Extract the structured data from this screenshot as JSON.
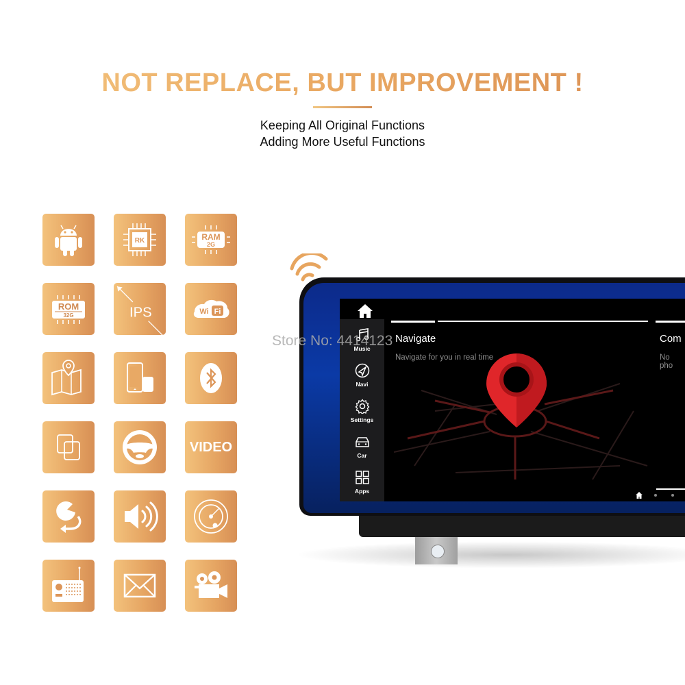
{
  "header": {
    "title": "NOT REPLACE, BUT IMPROVEMENT !",
    "subtitle_line1": "Keeping All Original Functions",
    "subtitle_line2": "Adding More Useful Functions",
    "accent_gradient": [
      "#f4c47e",
      "#d98e53"
    ]
  },
  "features": [
    {
      "icon": "android-icon",
      "label": ""
    },
    {
      "icon": "cpu-chip-icon",
      "label": "RK"
    },
    {
      "icon": "ram-chip-icon",
      "label": "RAM",
      "sublabel": "2G"
    },
    {
      "icon": "rom-chip-icon",
      "label": "ROM",
      "sublabel": "32G"
    },
    {
      "icon": "ips-screen-icon",
      "label": "IPS"
    },
    {
      "icon": "wifi-icon",
      "label": "Wi",
      "sublabel": "Fi"
    },
    {
      "icon": "map-pin-icon",
      "label": ""
    },
    {
      "icon": "phone-mirror-icon",
      "label": ""
    },
    {
      "icon": "bluetooth-icon",
      "label": ""
    },
    {
      "icon": "multi-window-icon",
      "label": ""
    },
    {
      "icon": "steering-wheel-icon",
      "label": ""
    },
    {
      "icon": "video-icon",
      "label": "VIDEO"
    },
    {
      "icon": "rotate-icon",
      "label": ""
    },
    {
      "icon": "speaker-icon",
      "label": ""
    },
    {
      "icon": "radar-icon",
      "label": ""
    },
    {
      "icon": "radio-icon",
      "label": ""
    },
    {
      "icon": "mail-icon",
      "label": ""
    },
    {
      "icon": "camera-icon",
      "label": ""
    }
  ],
  "device": {
    "watermark": "Store No: 4414123",
    "sidebar": [
      {
        "icon": "music-icon",
        "label": "Music"
      },
      {
        "icon": "navi-icon",
        "label": "Navi"
      },
      {
        "icon": "settings-icon",
        "label": "Settings"
      },
      {
        "icon": "car-icon",
        "label": "Car"
      },
      {
        "icon": "apps-icon",
        "label": "Apps"
      }
    ],
    "cards": [
      {
        "title": "Navigate",
        "subtitle": "Navigate for you in real time"
      },
      {
        "title": "Com",
        "subtitle": "No pho"
      }
    ],
    "pin_color": "#e0262a"
  }
}
